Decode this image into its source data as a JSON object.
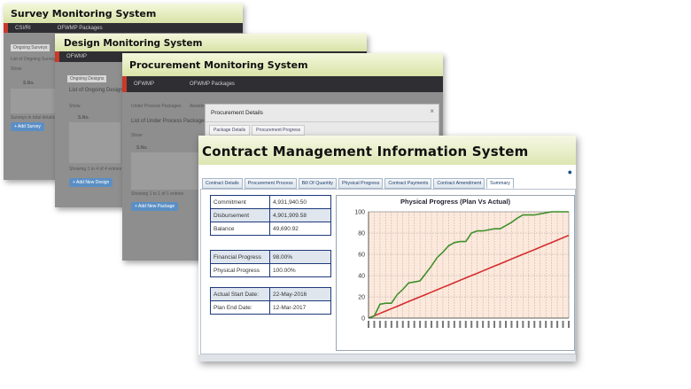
{
  "survey": {
    "title": "Survey Monitoring System",
    "nav": [
      "CSI/RI",
      "OFWMP Packages"
    ],
    "btn_a": "Ongoing Surveys",
    "txt_a": "List of Ongoing Surveys",
    "txt_b": "Show",
    "txt_c": "S.No.",
    "txt_d": "Surveys in total details",
    "btn_b": "+ Add Survey"
  },
  "design": {
    "title": "Design Monitoring System",
    "nav": [
      "OFWMP"
    ],
    "btn_a": "Ongoing Designs",
    "txt_a": "List of Ongoing Designs",
    "txt_b": "Show",
    "txt_c": "S.No.",
    "txt_d": "Showing 1 to 4 of 4 entries",
    "btn_b": "+ Add New Design"
  },
  "procurement": {
    "title": "Procurement Monitoring System",
    "nav": [
      "OFWMP",
      "OFWMP Packages"
    ],
    "txt_a": "Under Process Packages",
    "txt_b": "Awarded",
    "txt_c": "List of Under Process Packages",
    "txt_d": "Show",
    "txt_e": "S.No.",
    "txt_f": "Showing 1 to 1 of 1 entries",
    "btn": "+ Add New Package",
    "modal_title": "Procurement Details",
    "modal_close": "×",
    "modal_tabs": [
      "Package Details",
      "Procurement Progress"
    ]
  },
  "cmis": {
    "title": "Contract Management Information System",
    "icon": "help-icon",
    "tabs": [
      "Contract Details",
      "Procurement Process",
      "Bill Of Quantity",
      "Physical Progress",
      "Contract Payments",
      "Contract Amendment",
      "Summary"
    ],
    "active_tab": "Summary",
    "group1": [
      {
        "label": "Commitment",
        "value": "4,931,940.50"
      },
      {
        "label": "Disbursement",
        "value": "4,901,909.58"
      },
      {
        "label": "Balance",
        "value": "49,690.92"
      }
    ],
    "group2": [
      {
        "label": "Financial Progress",
        "value": "98.00%"
      },
      {
        "label": "Physical Progress",
        "value": "100.00%"
      }
    ],
    "group3": [
      {
        "label": "Actual Start Date:",
        "value": "22-May-2016"
      },
      {
        "label": "Plan End Date:",
        "value": "12-Mar-2017"
      }
    ]
  },
  "chart_data": {
    "type": "line",
    "title": "Physical Progress (Plan Vs Actual)",
    "ylim": [
      0,
      100
    ],
    "yticks": [
      0,
      20,
      40,
      60,
      80,
      100
    ],
    "grid": true,
    "colors": {
      "plan": "#d42d2d",
      "actual": "#3f8f2a",
      "background": "#fde9dc"
    },
    "series": [
      {
        "values": [
          0,
          2.2,
          4.4,
          6.7,
          8.9,
          11.1,
          13.3,
          15.6,
          17.8,
          20,
          22.2,
          24.4,
          26.7,
          28.9,
          31.1,
          33.3,
          35.6,
          37.8,
          40,
          42.2,
          44.4,
          46.7,
          48.9,
          51.1,
          53.3,
          55.6,
          57.8,
          60,
          62.2,
          64.4,
          66.7,
          68.9,
          71.1,
          73.3,
          75.6,
          77.8
        ]
      },
      {
        "values": [
          0,
          2,
          13,
          14,
          14,
          22,
          27,
          33,
          34,
          35,
          42,
          49,
          57,
          62,
          68,
          71,
          72,
          72,
          80,
          82,
          82,
          83,
          84,
          84,
          87,
          90,
          94,
          97,
          97,
          97,
          98,
          99,
          100,
          100,
          100,
          100
        ]
      }
    ]
  }
}
